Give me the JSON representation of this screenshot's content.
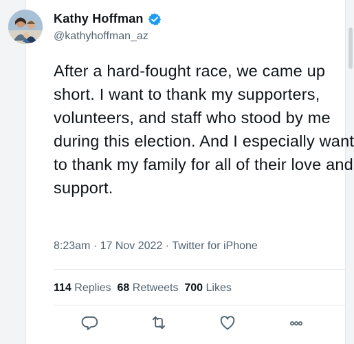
{
  "author": {
    "name": "Kathy Hoffman",
    "handle": "@kathyhoffman_az"
  },
  "tweet": {
    "text": "After a hard-fought race, we came up short. I want to thank my supporters, volunteers, and staff who stood by me during this election. And I especially want to thank my family for all of their love and support.",
    "time": "8:23am",
    "date": "17 Nov 2022",
    "source": "Twitter for iPhone"
  },
  "stats": {
    "replies_count": "114",
    "replies_label": "Replies",
    "retweets_count": "68",
    "retweets_label": "Retweets",
    "likes_count": "700",
    "likes_label": "Likes"
  },
  "icons": {
    "reply": "reply-icon",
    "retweet": "retweet-icon",
    "like": "heart-icon",
    "more": "more-icon",
    "verified": "verified-badge-icon"
  },
  "colors": {
    "verified": "#1d9bf0",
    "secondary_text": "#536471",
    "primary_text": "#0f1419"
  }
}
